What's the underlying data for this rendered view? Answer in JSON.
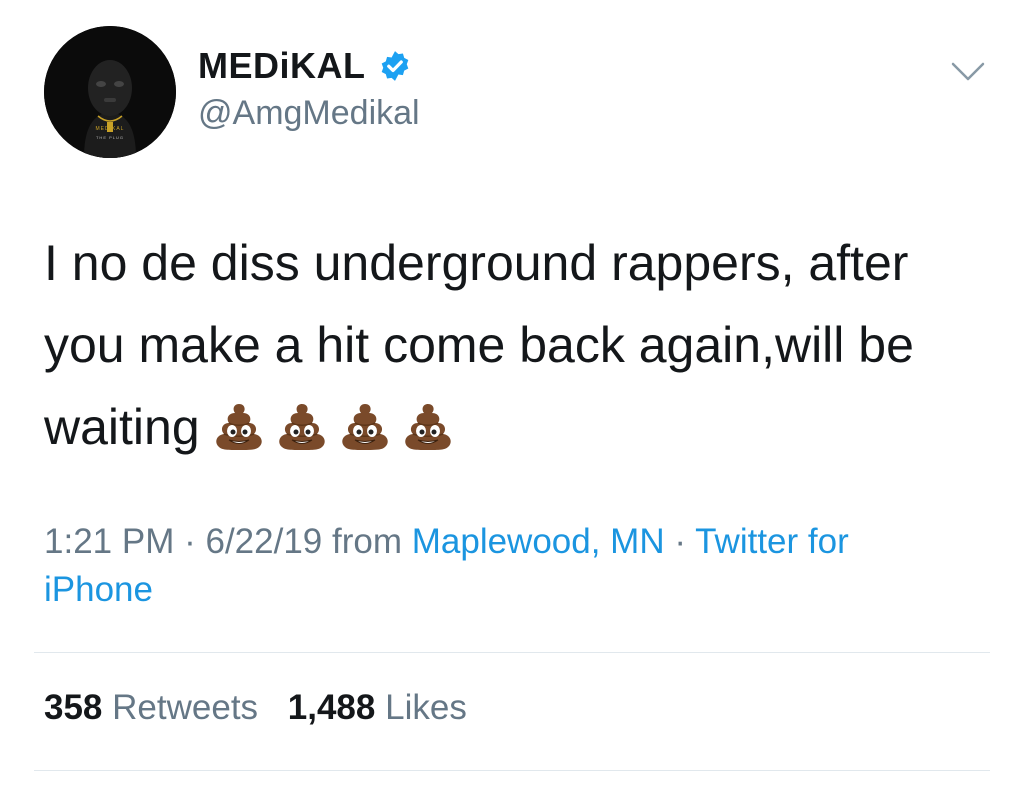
{
  "tweet": {
    "author": {
      "display_name": "MEDiKAL",
      "handle": "@AmgMedikal",
      "verified": true,
      "avatar_text_1": "MEDIKAL",
      "avatar_text_2": "THE PLUG"
    },
    "text_lines": [
      "I no de diss underground rappers, after",
      "you make a hit come back again,will be",
      "waiting"
    ],
    "emoji": [
      "pile-of-poo-icon",
      "pile-of-poo-icon",
      "pile-of-poo-icon",
      "pile-of-poo-icon"
    ],
    "time": "1:21 PM",
    "date": "6/22/19",
    "separator": "·",
    "from_label": "from",
    "location": "Maplewood, MN",
    "source_line_1": "Twitter for",
    "source_line_2": "iPhone",
    "stats": {
      "retweets_count": "358",
      "retweets_label": "Retweets",
      "likes_count": "1,488",
      "likes_label": "Likes"
    }
  },
  "colors": {
    "text": "#14171a",
    "secondary": "#657786",
    "link": "#1b95e0",
    "verified": "#1da1f2",
    "divider": "#e1e8ed"
  },
  "icons": {
    "verified": "verified-badge-icon",
    "more": "chevron-down-icon"
  }
}
